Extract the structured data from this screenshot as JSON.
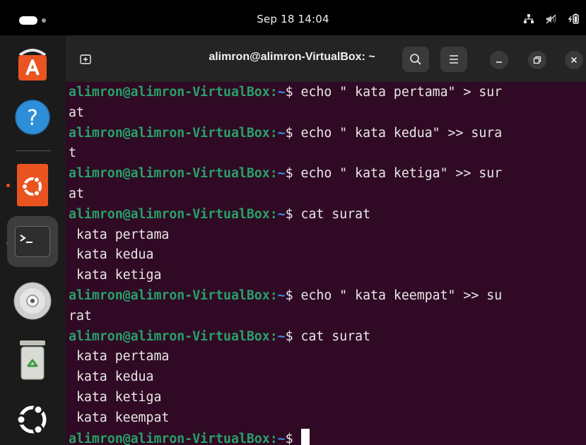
{
  "topbar": {
    "clock": "Sep 18  14:04"
  },
  "dock": {
    "items": [
      {
        "name": "software-center",
        "icon": "app-center-icon"
      },
      {
        "name": "help",
        "icon": "help-icon"
      },
      {
        "name": "ubuntu-app",
        "icon": "ubuntu-logo-icon"
      },
      {
        "name": "terminal",
        "icon": "terminal-icon"
      },
      {
        "name": "disc",
        "icon": "disc-icon"
      },
      {
        "name": "trash",
        "icon": "trash-icon"
      },
      {
        "name": "show-apps",
        "icon": "ubuntu-circle-icon"
      }
    ]
  },
  "window": {
    "title": "alimron@alimron-VirtualBox: ~"
  },
  "terminal": {
    "prompt_user": "alimron@alimron-VirtualBox",
    "prompt_path": "~",
    "lines": [
      {
        "type": "prompt",
        "cmd": " echo \" kata pertama\" > sur"
      },
      {
        "type": "output",
        "text": "at"
      },
      {
        "type": "prompt",
        "cmd": " echo \" kata kedua\" >> sura"
      },
      {
        "type": "output",
        "text": "t"
      },
      {
        "type": "prompt",
        "cmd": " echo \" kata ketiga\" >> sur"
      },
      {
        "type": "output",
        "text": "at"
      },
      {
        "type": "prompt",
        "cmd": " cat surat"
      },
      {
        "type": "output",
        "text": " kata pertama"
      },
      {
        "type": "output",
        "text": " kata kedua"
      },
      {
        "type": "output",
        "text": " kata ketiga"
      },
      {
        "type": "prompt",
        "cmd": " echo \" kata keempat\" >> su"
      },
      {
        "type": "output",
        "text": "rat"
      },
      {
        "type": "prompt",
        "cmd": " cat surat"
      },
      {
        "type": "output",
        "text": " kata pertama"
      },
      {
        "type": "output",
        "text": " kata kedua"
      },
      {
        "type": "output",
        "text": " kata ketiga"
      },
      {
        "type": "output",
        "text": " kata keempat"
      },
      {
        "type": "prompt",
        "cmd": " ",
        "cursor": true
      }
    ]
  },
  "colors": {
    "terminal_bg": "#300a24",
    "prompt_user": "#26a269",
    "prompt_path": "#3d8ee6",
    "accent": "#e95420"
  }
}
